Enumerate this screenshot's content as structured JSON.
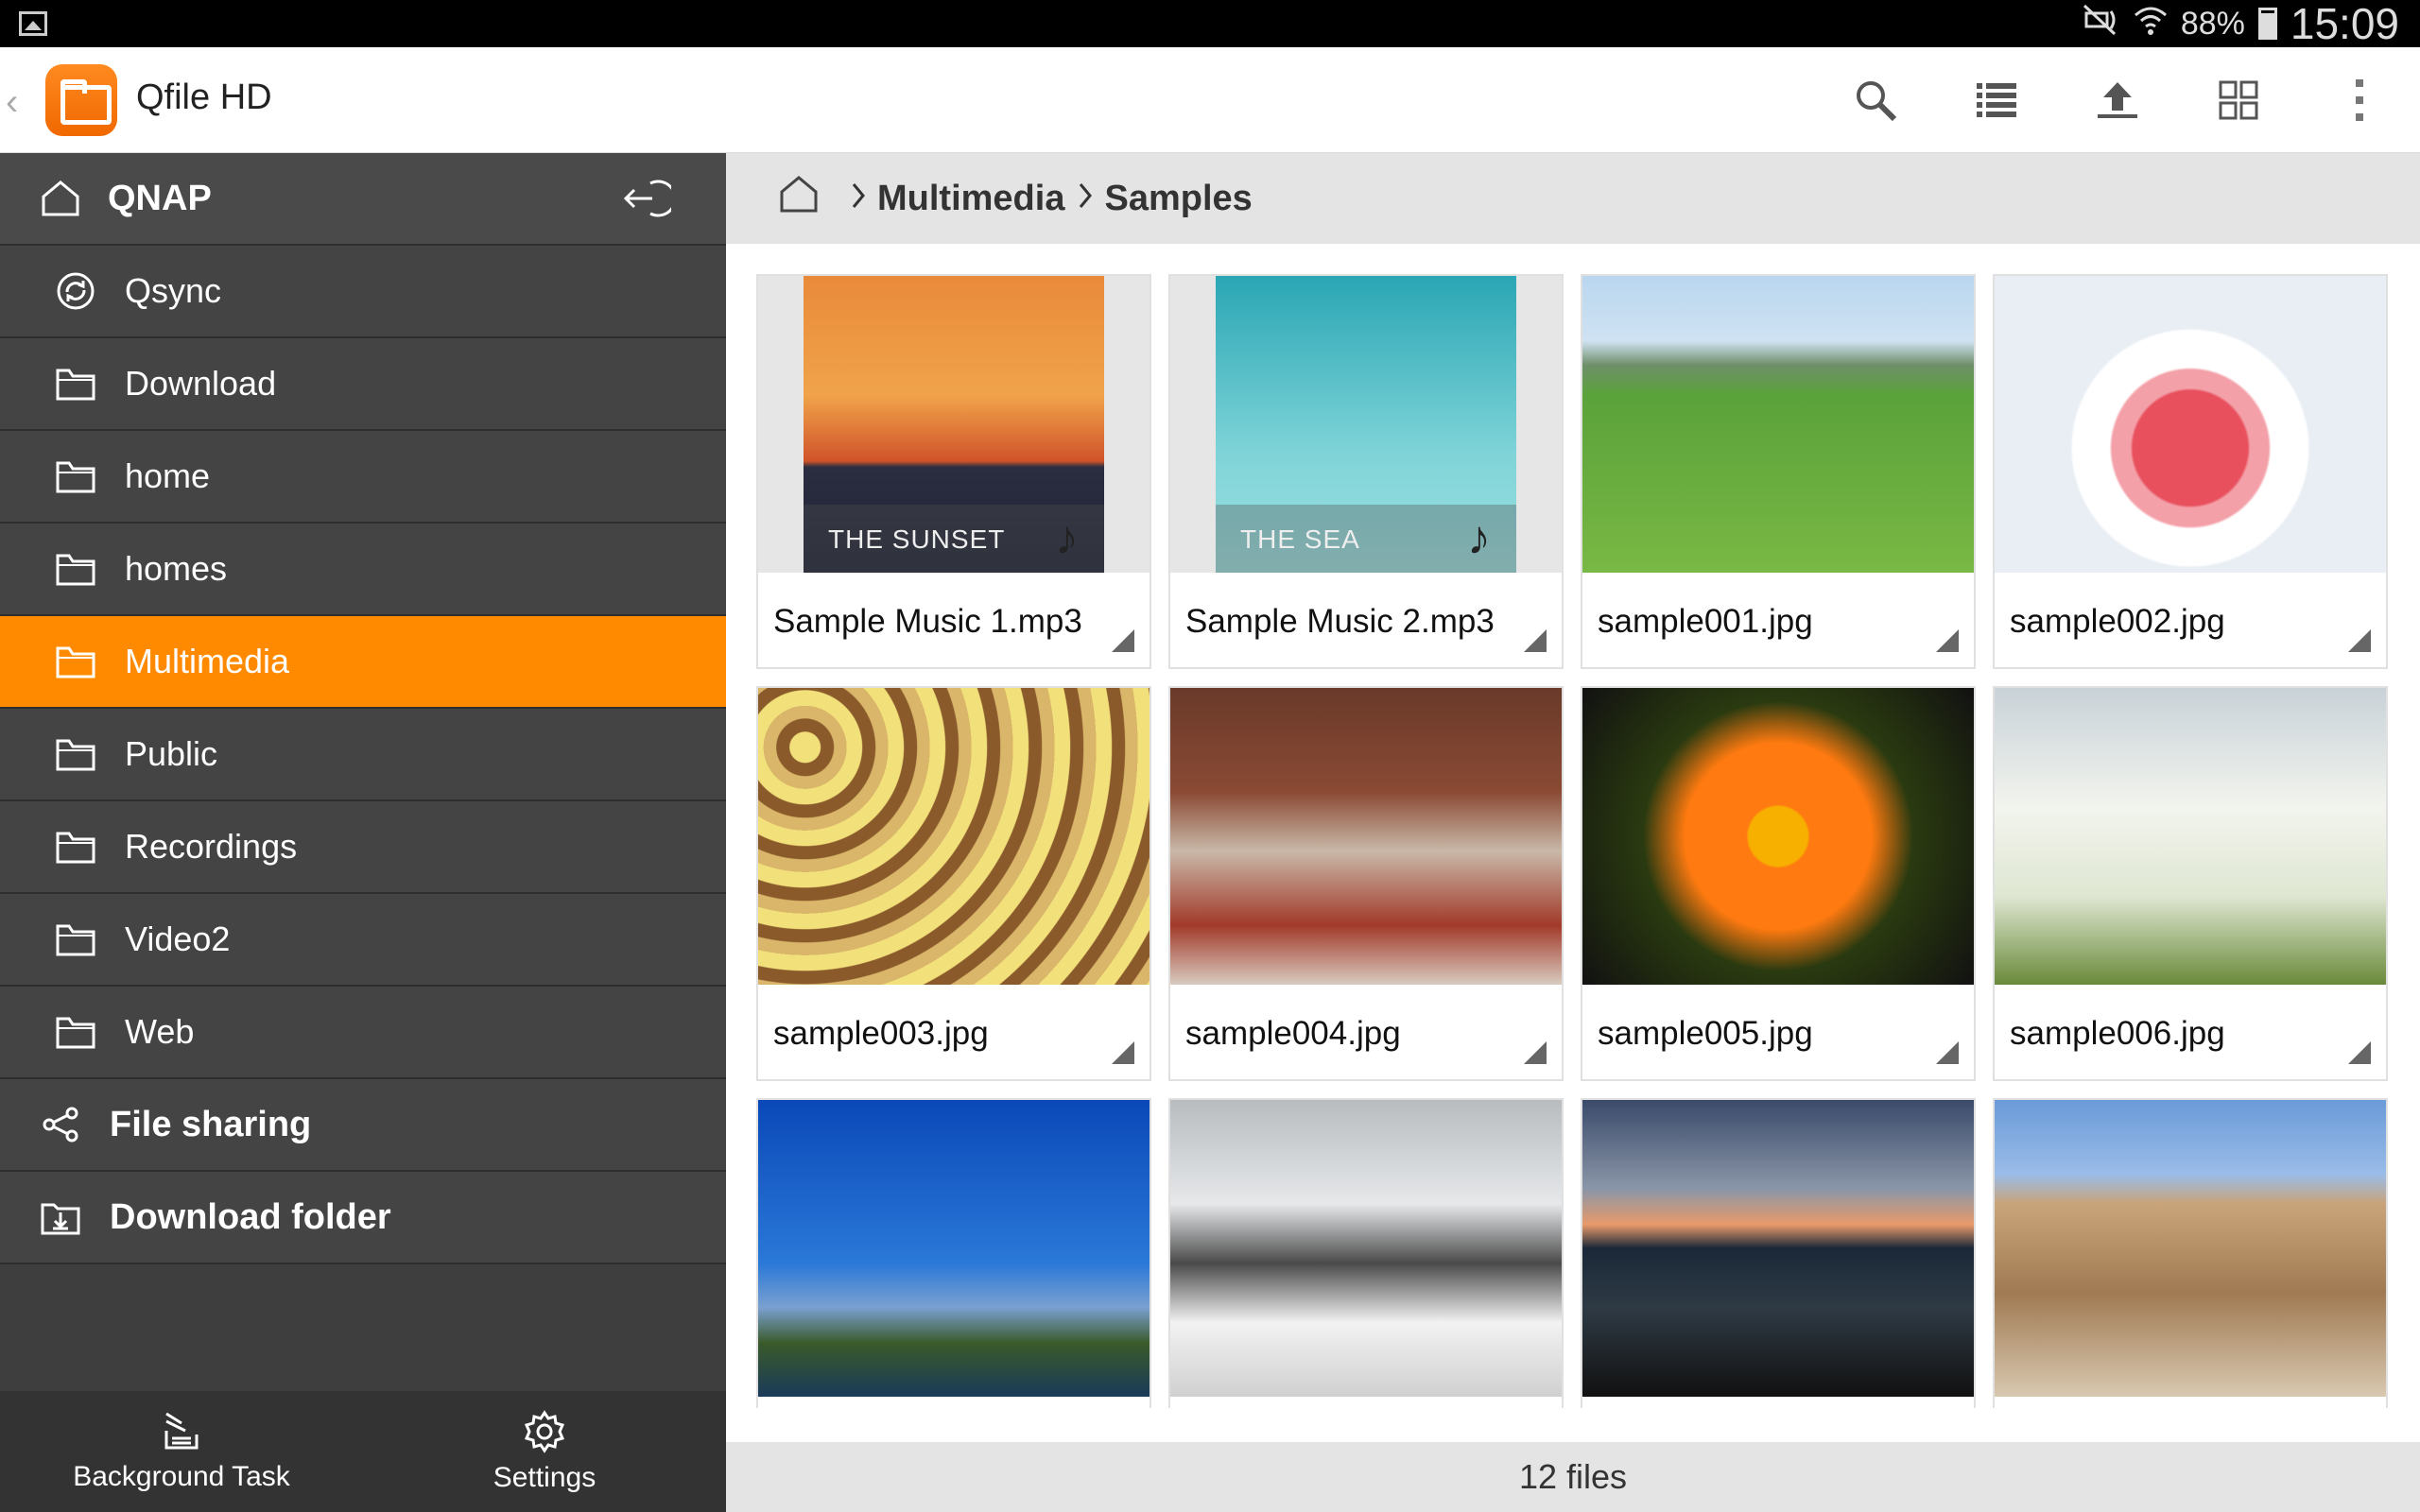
{
  "status_bar": {
    "battery": "88%",
    "time": "15:09"
  },
  "app": {
    "title": "Qfile HD"
  },
  "toolbar": {
    "icons": [
      "search-icon",
      "list-view-icon",
      "upload-icon",
      "select-icon",
      "overflow-menu-icon"
    ]
  },
  "sidebar": {
    "server": {
      "label": "QNAP"
    },
    "items": [
      {
        "label": "Qsync",
        "icon": "qsync-icon"
      },
      {
        "label": "Download",
        "icon": "folder-icon"
      },
      {
        "label": "home",
        "icon": "folder-icon"
      },
      {
        "label": "homes",
        "icon": "folder-icon"
      },
      {
        "label": "Multimedia",
        "icon": "folder-icon",
        "active": true
      },
      {
        "label": "Public",
        "icon": "folder-icon"
      },
      {
        "label": "Recordings",
        "icon": "folder-icon"
      },
      {
        "label": "Video2",
        "icon": "folder-icon"
      },
      {
        "label": "Web",
        "icon": "folder-icon"
      }
    ],
    "sections": [
      {
        "label": "File sharing",
        "icon": "share-icon"
      },
      {
        "label": "Download folder",
        "icon": "download-folder-icon"
      }
    ],
    "bottom": {
      "background_task": "Background Task",
      "settings": "Settings"
    }
  },
  "breadcrumb": {
    "items": [
      "Multimedia",
      "Samples"
    ]
  },
  "files": [
    {
      "name": "Sample Music 1.mp3",
      "thumb_text": "THE SUNSET"
    },
    {
      "name": "Sample Music 2.mp3",
      "thumb_text": "THE SEA"
    },
    {
      "name": "sample001.jpg"
    },
    {
      "name": "sample002.jpg"
    },
    {
      "name": "sample003.jpg"
    },
    {
      "name": "sample004.jpg"
    },
    {
      "name": "sample005.jpg"
    },
    {
      "name": "sample006.jpg"
    },
    {
      "name": ""
    },
    {
      "name": ""
    },
    {
      "name": ""
    },
    {
      "name": ""
    }
  ],
  "footer": {
    "count": "12 files"
  },
  "colors": {
    "accent": "#ff8a00",
    "sidebar_bg": "#3e3e3e"
  }
}
